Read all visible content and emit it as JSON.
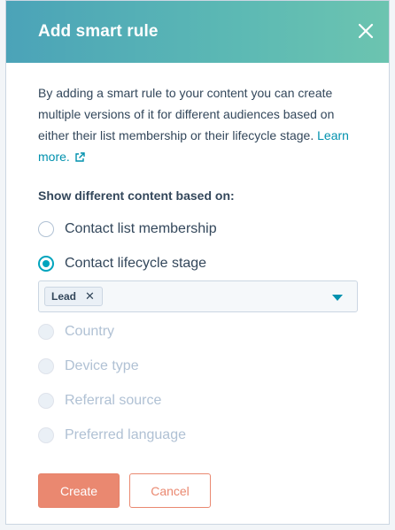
{
  "modal": {
    "title": "Add smart rule",
    "description": "By adding a smart rule to your content you can create multiple versions of it for different audiences based on either their list membership or their lifecycle stage.",
    "learn_more": "Learn more.",
    "section_label": "Show different content based on:",
    "options": [
      {
        "label": "Contact list membership",
        "checked": false,
        "disabled": false
      },
      {
        "label": "Contact lifecycle stage",
        "checked": true,
        "disabled": false
      },
      {
        "label": "Country",
        "checked": false,
        "disabled": true
      },
      {
        "label": "Device type",
        "checked": false,
        "disabled": true
      },
      {
        "label": "Referral source",
        "checked": false,
        "disabled": true
      },
      {
        "label": "Preferred language",
        "checked": false,
        "disabled": true
      }
    ],
    "lifecycle_select": {
      "selected_tags": [
        "Lead"
      ],
      "remove_symbol": "✕"
    },
    "buttons": {
      "create": "Create",
      "cancel": "Cancel"
    }
  },
  "colors": {
    "header_gradient_start": "#4ba3b8",
    "header_gradient_end": "#6cc4b0",
    "link": "#0091ae",
    "radio_accent": "#00a4bd",
    "primary_button": "#ea8870",
    "text": "#33475b",
    "disabled_text": "#b0c1d4"
  },
  "icons": {
    "close": "close-icon",
    "external_link": "external-link-icon",
    "dropdown_caret": "caret-down-icon"
  }
}
